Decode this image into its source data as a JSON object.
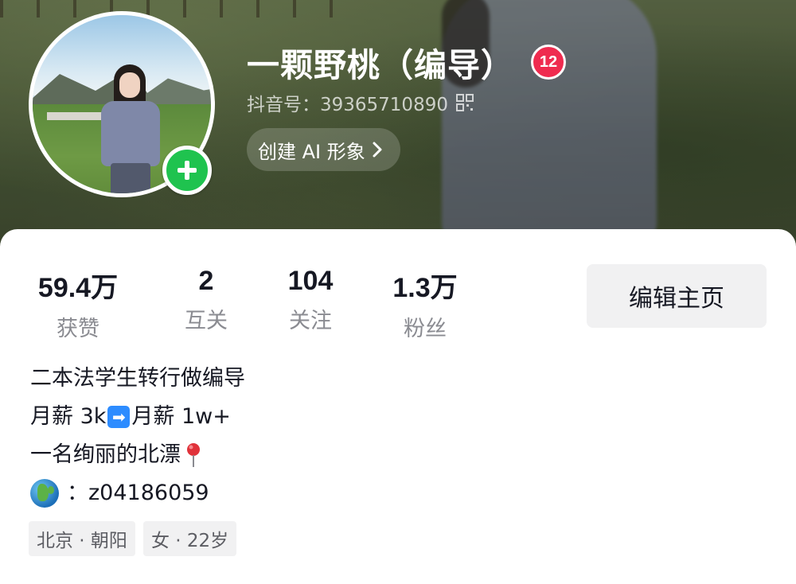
{
  "profile": {
    "nickname": "一颗野桃（编导）",
    "badge_count": "12",
    "douyin_id": "抖音号：39365710890",
    "ai_button": "创建 AI 形象"
  },
  "stats": [
    {
      "value": "59.4万",
      "label": "获赞"
    },
    {
      "value": "2",
      "label": "互关"
    },
    {
      "value": "104",
      "label": "关注"
    },
    {
      "value": "1.3万",
      "label": "粉丝"
    }
  ],
  "edit_button": "编辑主页",
  "bio": {
    "line1": "二本法学生转行做编导",
    "line2_left": "月薪 3k",
    "line2_arrow": "➡",
    "line2_right": "月薪 1w+",
    "line3": "一名绚丽的北漂",
    "line4": "：z04186059"
  },
  "tags": [
    "北京 · 朝阳",
    "女 · 22岁"
  ],
  "icons": {
    "add": "plus-icon",
    "qr": "qr-code-icon",
    "chevron": "chevron-right-icon",
    "pin": "location-pin-icon",
    "globe": "globe-icon"
  },
  "colors": {
    "badge": "#ef2b4f",
    "add_button": "#1fc34f",
    "arrow_emoji": "#2d8cff"
  }
}
